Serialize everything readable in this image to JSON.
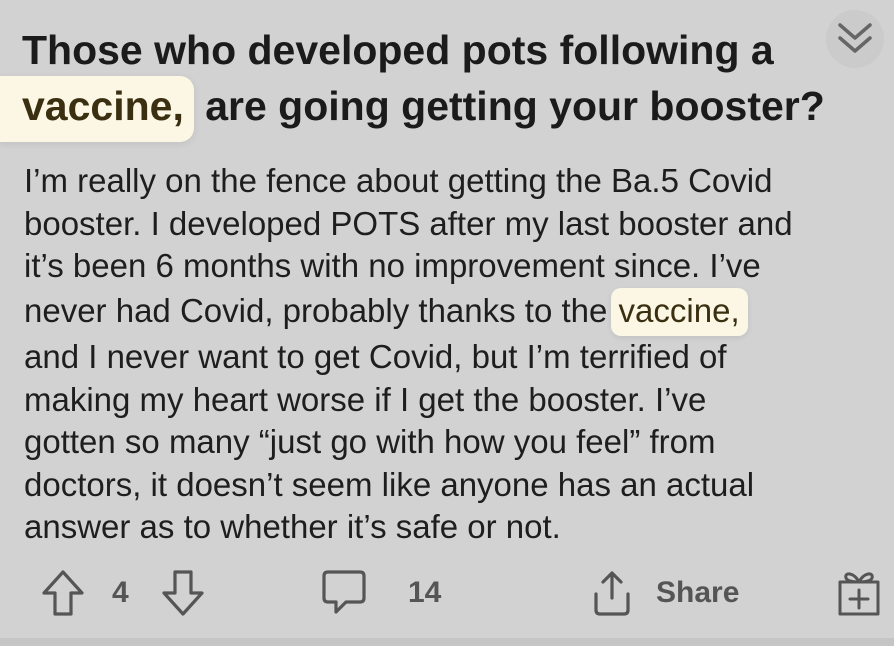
{
  "post": {
    "title_before": "Those who developed pots following a",
    "title_highlight": "vaccine,",
    "title_after": " are going getting your booster?",
    "body_lines": [
      "I’m really on the fence about getting the Ba.5 Covid",
      "booster. I developed POTS after my last booster and",
      "it’s been 6 months with no improvement since. I’ve",
      "never had Covid, probably thanks to the ",
      "and I never want to get Covid, but I’m terrified of",
      "making my heart worse if I get the booster. I’ve",
      "gotten so many “just go with how you feel” from",
      "doctors, it doesn’t seem like anyone has an actual",
      "answer as to whether it’s safe or not."
    ],
    "body_highlight": "vaccine,"
  },
  "actions": {
    "vote_count": "4",
    "comment_count": "14",
    "share_label": "Share"
  },
  "icons": {
    "collapse": "chevron-down-double-icon",
    "upvote": "arrow-up-icon",
    "downvote": "arrow-down-icon",
    "comment": "comment-bubble-icon",
    "share": "share-icon",
    "award": "gift-icon"
  },
  "colors": {
    "background": "#d2d2d2",
    "highlight": "#fbf7e4",
    "text": "#1e1e1e",
    "icon": "#555555"
  }
}
